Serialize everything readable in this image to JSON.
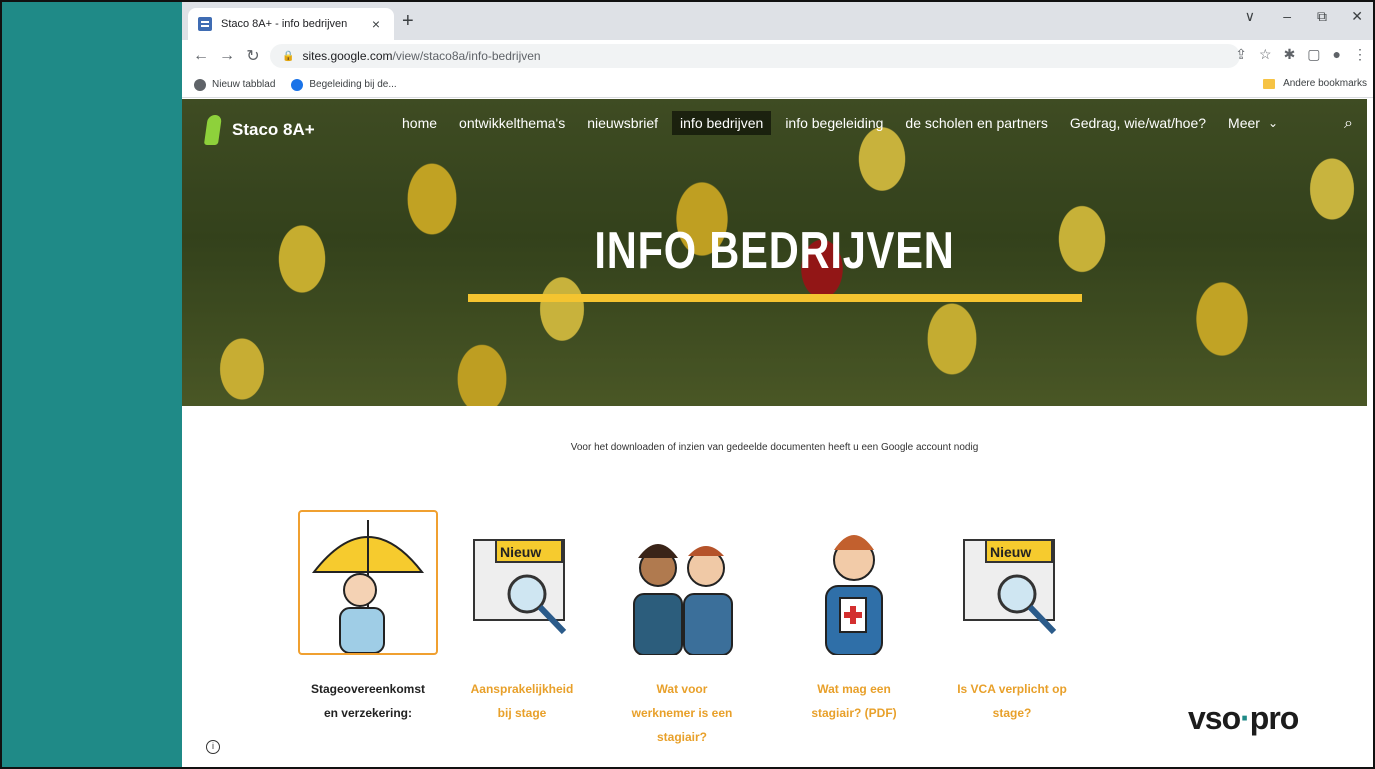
{
  "browser": {
    "tab_title": "Staco 8A+ - info bedrijven",
    "tab_close": "×",
    "new_tab": "+",
    "url_host": "sites.google.com",
    "url_path": "/view/staco8a/info-bedrijven",
    "window_controls": [
      "∨",
      "–",
      "⧉",
      "✕"
    ]
  },
  "bookmarks": {
    "items": [
      "Nieuw tabblad",
      "Begeleiding bij de..."
    ],
    "other": "Andere bookmarks"
  },
  "site": {
    "name": "Staco 8A+",
    "nav": [
      "home",
      "ontwikkelthema's",
      "nieuwsbrief",
      "info bedrijven",
      "info begeleiding",
      "de scholen en partners",
      "Gedrag, wie/wat/hoe?",
      "Meer"
    ],
    "active_nav": "info bedrijven"
  },
  "hero": {
    "title": "INFO BEDRIJVEN",
    "accent_color": "#f4c430"
  },
  "content": {
    "notice": "Voor het downloaden of inzien van gedeelde documenten heeft u een Google account nodig",
    "cards": [
      {
        "line1": "Stageovereenkomst",
        "line2": "en verzekering:",
        "line3": "",
        "badge": ""
      },
      {
        "line1": "Aansprakelijkheid",
        "line2": "bij stage",
        "line3": "",
        "badge": "Nieuw"
      },
      {
        "line1": "Wat voor",
        "line2": "werknemer is een",
        "line3": "stagiair?",
        "badge": ""
      },
      {
        "line1": "Wat mag een",
        "line2": "stagiair? (PDF)",
        "line3": "",
        "badge": ""
      },
      {
        "line1": "Is VCA verplicht op",
        "line2": "stage?",
        "line3": "",
        "badge": "Nieuw"
      }
    ],
    "logo_left": "vso",
    "logo_dot": "·",
    "logo_right": "pro",
    "info_icon": "i"
  }
}
